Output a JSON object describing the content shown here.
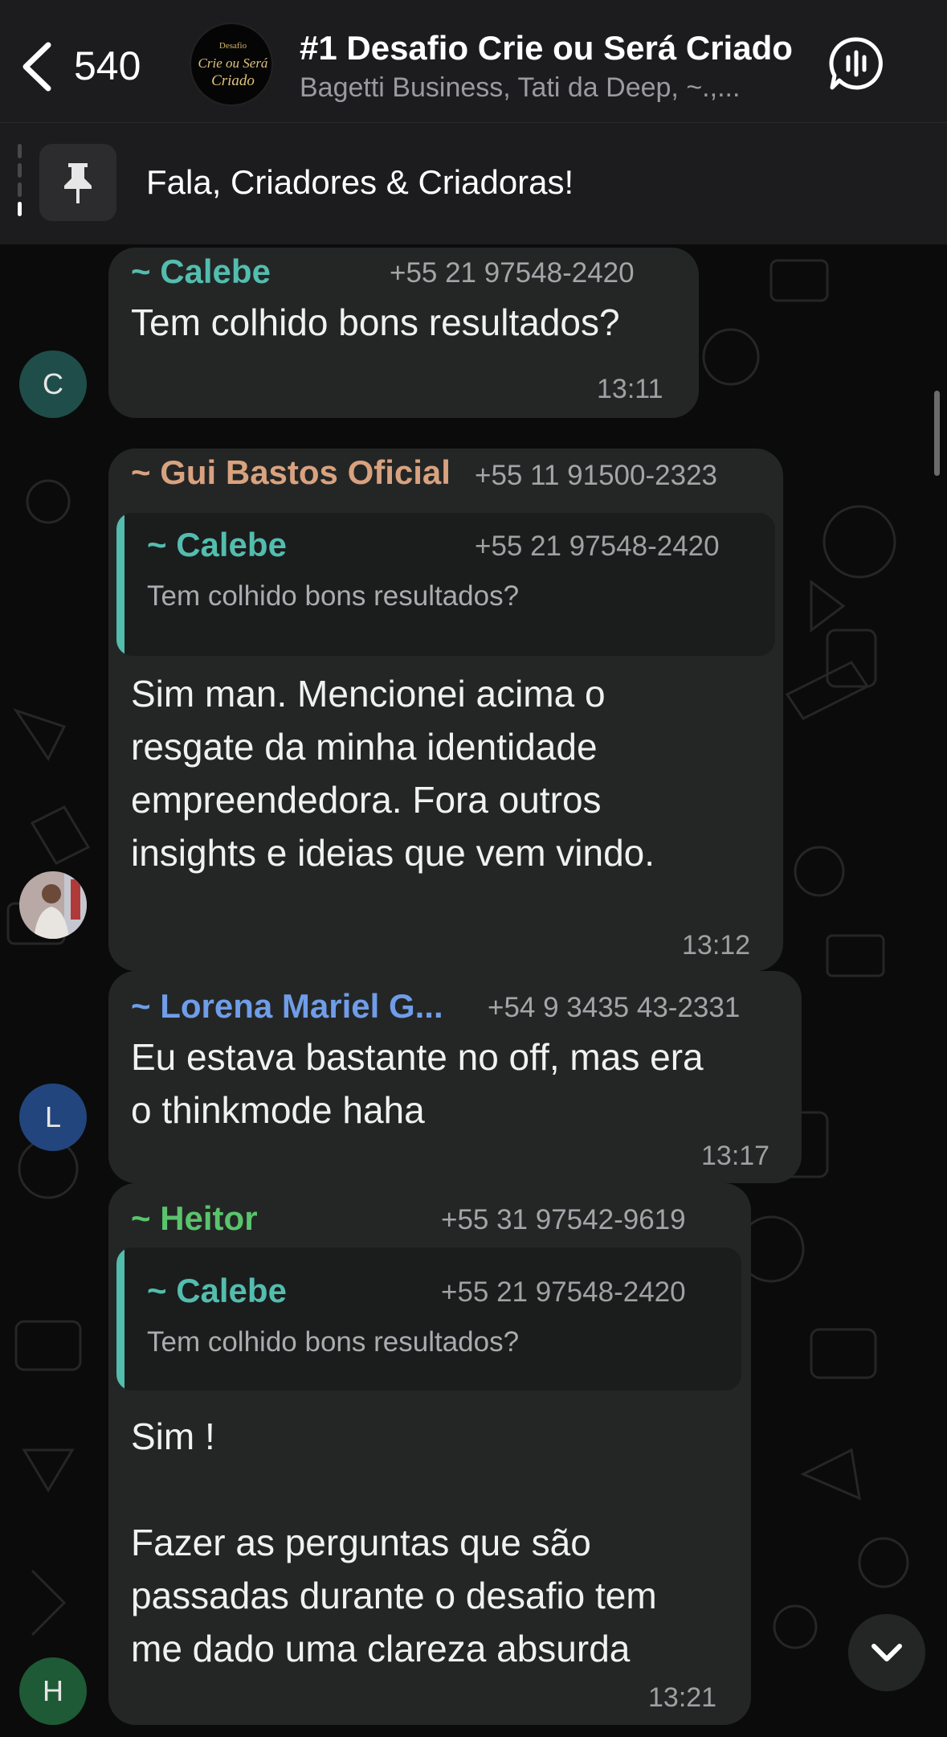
{
  "header": {
    "back_count": "540",
    "group_title": "#1 Desafio Crie ou Será Criado",
    "group_subtitle": "Bagetti Business, Tati da Deep, ~.,...",
    "avatar_logo_lines": [
      "Desafio",
      "Crie ou Será",
      "Criado"
    ]
  },
  "pinned": {
    "text": "Fala, Criadores & Criadoras!"
  },
  "messages": [
    {
      "sender": "~ Calebe",
      "phone": "+55 21 97548-2420",
      "text": "Tem colhido bons resultados?",
      "time": "13:11",
      "sender_color": "#53bdae",
      "avatar_letter": "C",
      "avatar_color": "#1f4d4a"
    },
    {
      "sender": "~ Gui Bastos Oficial",
      "phone": "+55 11 91500-2323",
      "quote": {
        "sender": "~ Calebe",
        "phone": "+55 21 97548-2420",
        "text": "Tem colhido bons resultados?"
      },
      "text": "Sim man. Mencionei acima o\nresgate da minha identidade\nempreendedora. Fora outros\ninsights e ideias que vem vindo.",
      "time": "13:12",
      "sender_color": "#d9a27f"
    },
    {
      "sender": "~ Lorena Mariel G...",
      "phone": "+54 9 3435 43-2331",
      "text": "Eu estava bastante no off, mas era\no thinkmode haha",
      "time": "13:17",
      "sender_color": "#6f9de8",
      "avatar_letter": "L",
      "avatar_color": "#22457e"
    },
    {
      "sender": "~ Heitor",
      "phone": "+55 31 97542-9619",
      "quote": {
        "sender": "~ Calebe",
        "phone": "+55 21 97548-2420",
        "text": "Tem colhido bons resultados?"
      },
      "text": "Sim !\n\nFazer as perguntas que são\npassadas durante o desafio tem\nme dado uma clareza absurda",
      "time": "13:21",
      "sender_color": "#5ac46b",
      "avatar_letter": "H",
      "avatar_color": "#1e5a35"
    }
  ],
  "colors": {
    "background": "#0b0b0b",
    "header": "#1c1c1e",
    "bubble": "#242626",
    "quote_accent": "#53bdae"
  },
  "icons": [
    "chevron-left-icon",
    "group-logo",
    "voice-chat-icon",
    "pin-icon",
    "chevron-down-icon"
  ]
}
